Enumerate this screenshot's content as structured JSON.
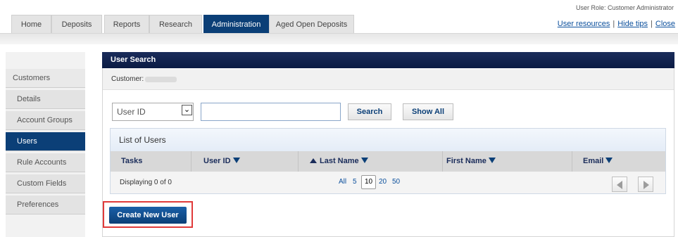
{
  "header": {
    "tabs": [
      {
        "label": "Home"
      },
      {
        "label": "Deposits"
      },
      {
        "label": "Reports"
      },
      {
        "label": "Research"
      },
      {
        "label": "Administration",
        "active": true
      },
      {
        "label": "Aged Open Deposits"
      }
    ],
    "user_role": "User Role: Customer Administrator",
    "links": {
      "user_resources": "User resources",
      "hide_tips": "Hide tips",
      "close": "Close",
      "separator": "|"
    }
  },
  "sidebar": {
    "items": [
      {
        "label": "Customers"
      },
      {
        "label": "Details"
      },
      {
        "label": "Account Groups"
      },
      {
        "label": "Users",
        "active": true
      },
      {
        "label": "Rule Accounts"
      },
      {
        "label": "Custom Fields"
      },
      {
        "label": "Preferences"
      }
    ]
  },
  "main": {
    "title": "User Search",
    "customer_label": "Customer:",
    "search": {
      "field_select": "User ID",
      "query_value": "",
      "search_button": "Search",
      "show_all_button": "Show All"
    },
    "list": {
      "title": "List of Users",
      "columns": [
        "Tasks",
        "User ID",
        "Last Name",
        "First Name",
        "Email"
      ],
      "sorted_column": "Last Name",
      "sort_direction": "ascending",
      "displaying": "Displaying 0 of 0",
      "page_sizes": [
        "All",
        "5",
        "10",
        "20",
        "50"
      ],
      "selected_page_size": "10"
    },
    "create_button": "Create New User"
  },
  "colors": {
    "nav_active": "#0b3f77",
    "panel_header": "#0b1b44",
    "link": "#0b4f9c",
    "highlight": "#e03a3a"
  }
}
